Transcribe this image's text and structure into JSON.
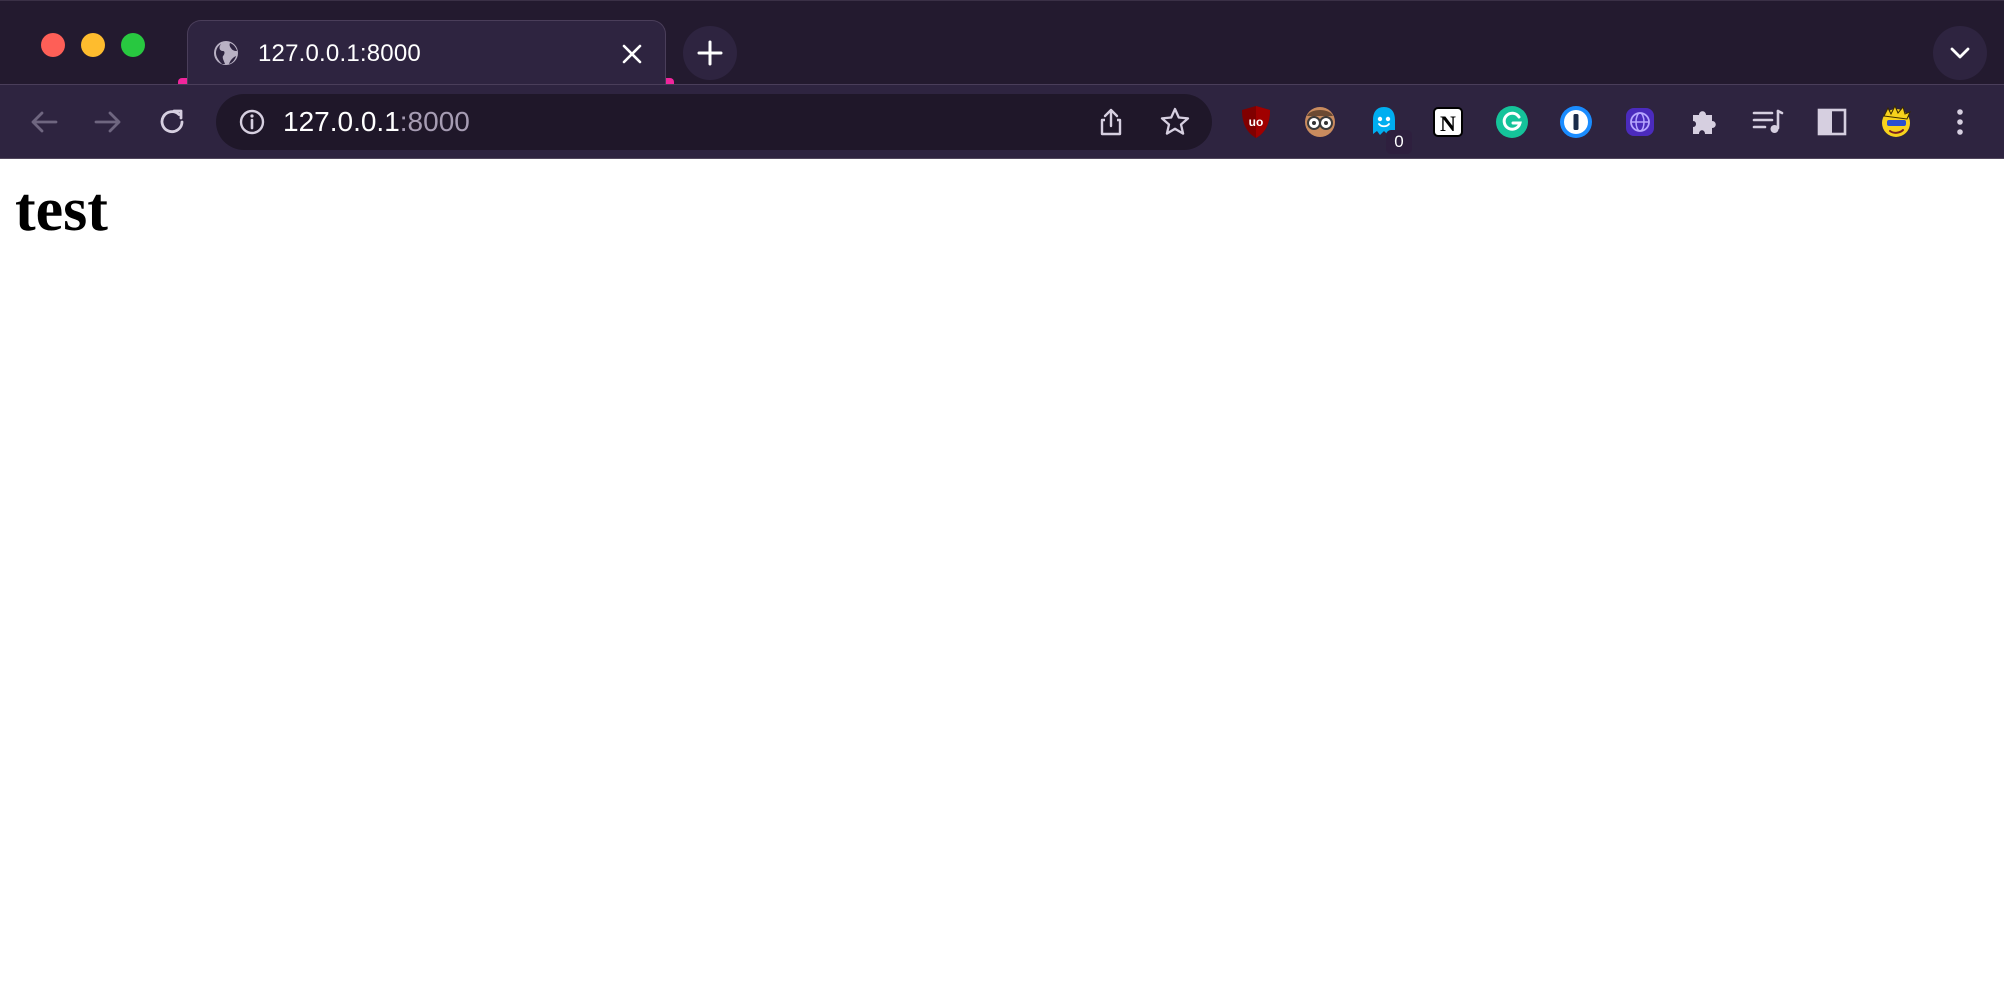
{
  "window": {
    "traffic_lights": [
      "close",
      "minimize",
      "zoom"
    ]
  },
  "tab": {
    "title": "127.0.0.1:8000",
    "favicon": "globe-icon",
    "accent_color": "#f0259c"
  },
  "toolbar": {
    "url_host": "127.0.0.1",
    "url_port": ":8000",
    "extensions": [
      {
        "name": "ublock-origin-icon"
      },
      {
        "name": "reader-glasses-icon"
      },
      {
        "name": "ghostery-icon",
        "badge": "0"
      },
      {
        "name": "notion-icon"
      },
      {
        "name": "grammarly-icon"
      },
      {
        "name": "onepassword-icon"
      },
      {
        "name": "web-extension-icon"
      },
      {
        "name": "puzzle-icon"
      },
      {
        "name": "media-queue-icon"
      },
      {
        "name": "side-panel-icon"
      },
      {
        "name": "profile-avatar-icon"
      },
      {
        "name": "kebab-menu-icon"
      }
    ]
  },
  "page": {
    "heading": "test"
  },
  "colors": {
    "tabstrip_bg": "#231a2f",
    "toolbar_bg": "#2e2440",
    "omnibox_bg": "#1f1729"
  }
}
